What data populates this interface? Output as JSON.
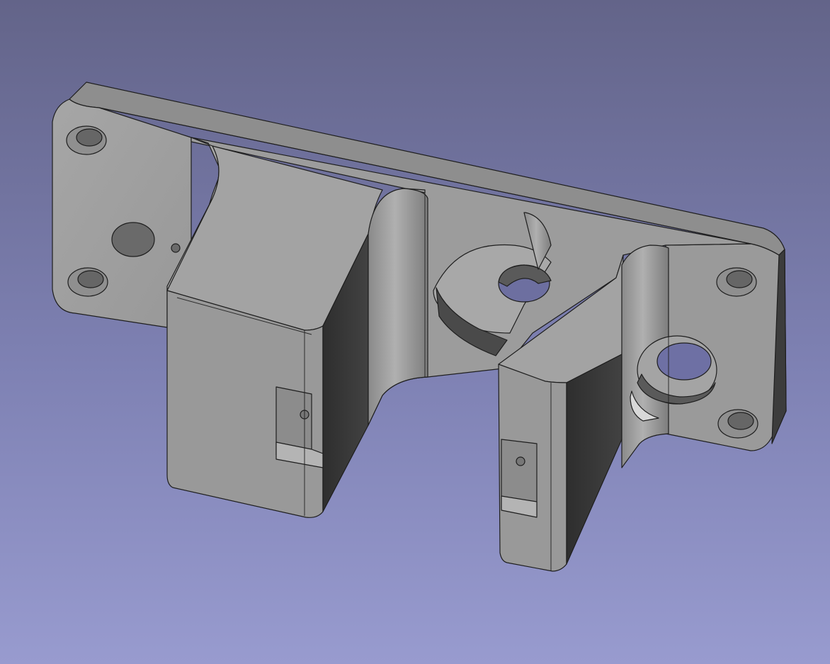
{
  "app": {
    "view": "3d-viewport"
  },
  "viewport": {
    "background_top": "#636489",
    "background_bottom": "#989bcf"
  },
  "model": {
    "kind": "extruded-mounting-bracket",
    "render_style": "shaded-with-edges",
    "colors": {
      "face_light": "#a0a0a0",
      "face_mid": "#8e8e8e",
      "face_dark": "#3b3b3b",
      "face_shadow": "#2f2f2f",
      "edge": "#1e1e1e",
      "hole_inner": "#6f6f6f"
    }
  }
}
